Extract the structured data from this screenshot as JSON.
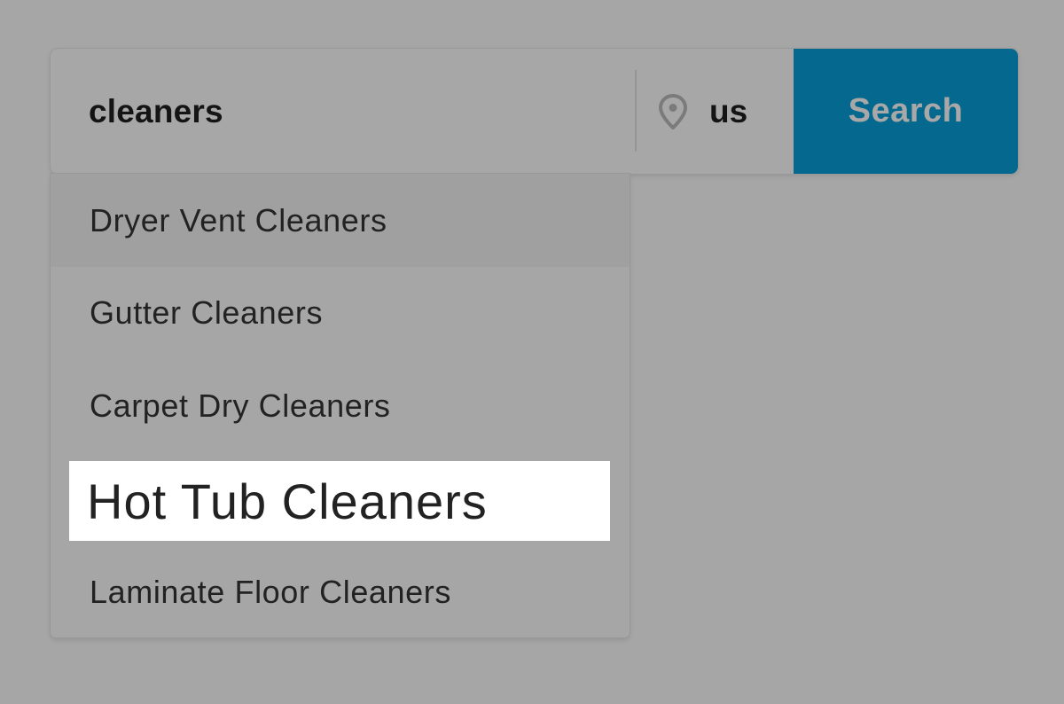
{
  "search": {
    "query": "cleaners",
    "location": "us",
    "button_label": "Search",
    "location_icon": "map-pin-icon"
  },
  "suggestions": [
    {
      "label": "Dryer Vent Cleaners",
      "active": true
    },
    {
      "label": "Gutter Cleaners",
      "active": false
    },
    {
      "label": "Carpet Dry Cleaners",
      "active": false
    },
    {
      "label": "Hot Tub Cleaners",
      "active": false,
      "highlighted": true
    },
    {
      "label": "Laminate Floor Cleaners",
      "active": false
    }
  ],
  "colors": {
    "background": "#a6a6a6",
    "search_button": "#05698f",
    "highlight": "#ffffff"
  }
}
